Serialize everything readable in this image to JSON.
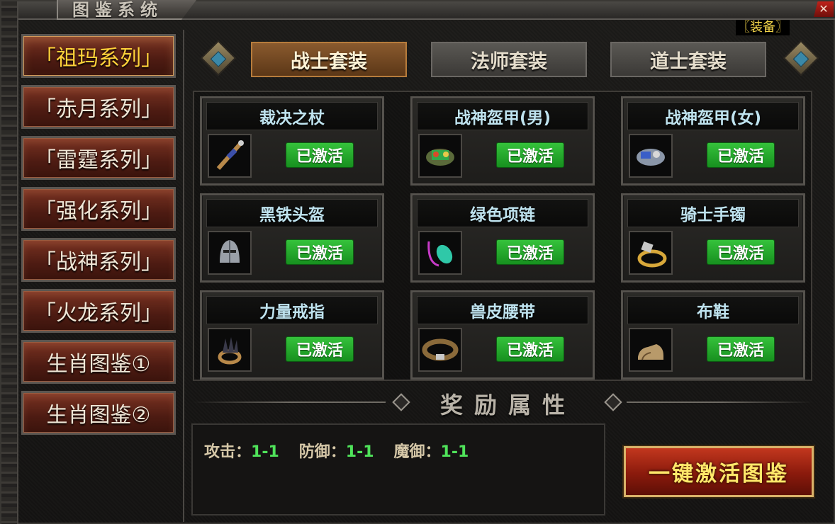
{
  "window": {
    "title": "图鉴系统",
    "close_icon": "✕",
    "equip_tag": "〖装备〗"
  },
  "sidebar": {
    "items": [
      {
        "label": "「祖玛系列」",
        "active": true
      },
      {
        "label": "「赤月系列」",
        "active": false
      },
      {
        "label": "「雷霆系列」",
        "active": false
      },
      {
        "label": "「强化系列」",
        "active": false
      },
      {
        "label": "「战神系列」",
        "active": false
      },
      {
        "label": "「火龙系列」",
        "active": false
      },
      {
        "label": "生肖图鉴①",
        "active": false
      },
      {
        "label": "生肖图鉴②",
        "active": false
      }
    ]
  },
  "tabs": [
    {
      "label": "战士套装",
      "active": true
    },
    {
      "label": "法师套装",
      "active": false
    },
    {
      "label": "道士套装",
      "active": false
    }
  ],
  "cards": [
    {
      "name": "裁决之杖",
      "status": "已激活",
      "icon": "sword-icon"
    },
    {
      "name": "战神盔甲(男)",
      "status": "已激活",
      "icon": "armor-icon"
    },
    {
      "name": "战神盔甲(女)",
      "status": "已激活",
      "icon": "armor-icon"
    },
    {
      "name": "黑铁头盔",
      "status": "已激活",
      "icon": "helmet-icon"
    },
    {
      "name": "绿色项链",
      "status": "已激活",
      "icon": "necklace-icon"
    },
    {
      "name": "骑士手镯",
      "status": "已激活",
      "icon": "bracelet-icon"
    },
    {
      "name": "力量戒指",
      "status": "已激活",
      "icon": "ring-icon"
    },
    {
      "name": "兽皮腰带",
      "status": "已激活",
      "icon": "belt-icon"
    },
    {
      "name": "布鞋",
      "status": "已激活",
      "icon": "boots-icon"
    }
  ],
  "reward": {
    "title": "奖励属性",
    "attributes": [
      {
        "label": "攻击：",
        "value": "1-1"
      },
      {
        "label": "防御：",
        "value": "1-1"
      },
      {
        "label": "魔御：",
        "value": "1-1"
      }
    ]
  },
  "actions": {
    "activate_all": "一键激活图鉴"
  },
  "colors": {
    "active_tab": "#8a5a2e",
    "sidebar_btn": "#7a3322",
    "status_green": "#35c23b",
    "card_title": "#bfe3ef",
    "attr_value": "#4fe35a",
    "active_sidebar_text": "#ffd23a"
  }
}
